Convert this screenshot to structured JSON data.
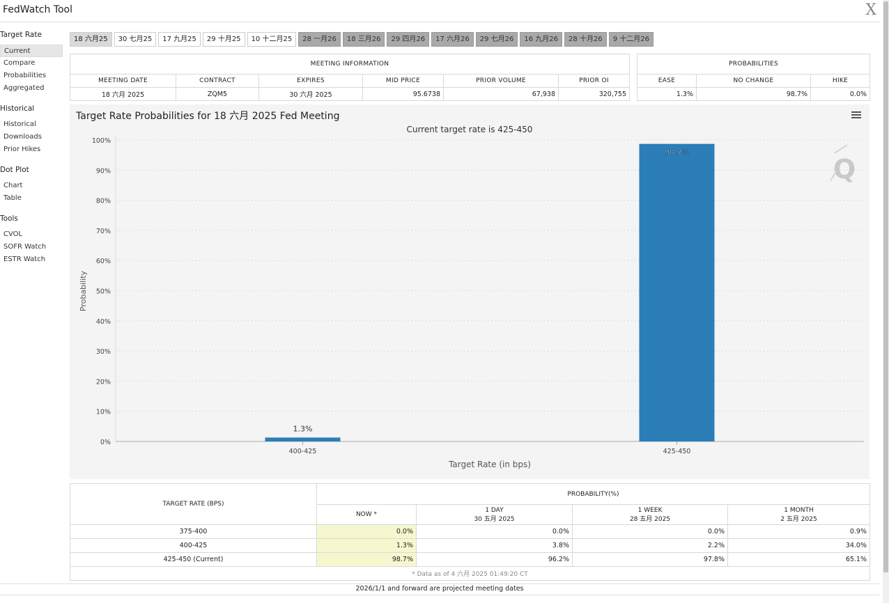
{
  "app": {
    "title": "FedWatch Tool",
    "close_label": "X"
  },
  "sidebar": {
    "groups": [
      {
        "label": "Target Rate",
        "items": [
          "Current",
          "Compare",
          "Probabilities",
          "Aggregated"
        ]
      },
      {
        "label": "Historical",
        "items": [
          "Historical",
          "Downloads",
          "Prior Hikes"
        ]
      },
      {
        "label": "Dot Plot",
        "items": [
          "Chart",
          "Table"
        ]
      },
      {
        "label": "Tools",
        "items": [
          "CVOL",
          "SOFR Watch",
          "ESTR Watch"
        ]
      }
    ],
    "active": "Current"
  },
  "tabs": [
    {
      "label": "18 六月25",
      "state": "selected"
    },
    {
      "label": "30 七月25",
      "state": "normal"
    },
    {
      "label": "17 九月25",
      "state": "normal"
    },
    {
      "label": "29 十月25",
      "state": "normal"
    },
    {
      "label": "10 十二月25",
      "state": "normal"
    },
    {
      "label": "28 一月26",
      "state": "future"
    },
    {
      "label": "18 三月26",
      "state": "future"
    },
    {
      "label": "29 四月26",
      "state": "future"
    },
    {
      "label": "17 六月26",
      "state": "future"
    },
    {
      "label": "29 七月26",
      "state": "future"
    },
    {
      "label": "16 九月26",
      "state": "future"
    },
    {
      "label": "28 十月26",
      "state": "future"
    },
    {
      "label": "9 十二月26",
      "state": "future"
    }
  ],
  "meeting_info": {
    "header": "MEETING INFORMATION",
    "columns": [
      "MEETING DATE",
      "CONTRACT",
      "EXPIRES",
      "MID PRICE",
      "PRIOR VOLUME",
      "PRIOR OI"
    ],
    "row": [
      "18 六月 2025",
      "ZQM5",
      "30 六月 2025",
      "95.6738",
      "67,938",
      "320,755"
    ]
  },
  "probabilities": {
    "header": "PROBABILITIES",
    "columns": [
      "EASE",
      "NO CHANGE",
      "HIKE"
    ],
    "row": [
      "1.3%",
      "98.7%",
      "0.0%"
    ]
  },
  "chart_panel": {
    "title": "Target Rate Probabilities for 18 六月 2025 Fed Meeting",
    "menu_icon": "hamburger-menu-icon",
    "watermark_icon": "q-logo-icon"
  },
  "chart_data": {
    "type": "bar",
    "title": "Current target rate is 425-450",
    "xlabel": "Target Rate (in bps)",
    "ylabel": "Probability",
    "categories": [
      "400-425",
      "425-450"
    ],
    "values": [
      1.3,
      98.7
    ],
    "value_labels": [
      "1.3%",
      "98.7%"
    ],
    "ylim": [
      0,
      100
    ],
    "yticks": [
      "0%",
      "10%",
      "20%",
      "30%",
      "40%",
      "50%",
      "60%",
      "70%",
      "80%",
      "90%",
      "100%"
    ],
    "grid": true,
    "bar_color": "#2b7eb8"
  },
  "prob_table": {
    "col1_header": "TARGET RATE (BPS)",
    "group_header": "PROBABILITY(%)",
    "columns": [
      {
        "line1": "NOW *",
        "line2": ""
      },
      {
        "line1": "1 DAY",
        "line2": "30 五月 2025"
      },
      {
        "line1": "1 WEEK",
        "line2": "28 五月 2025"
      },
      {
        "line1": "1 MONTH",
        "line2": "2 五月 2025"
      }
    ],
    "rows": [
      {
        "rate": "375-400",
        "values": [
          "0.0%",
          "0.0%",
          "0.0%",
          "0.9%"
        ]
      },
      {
        "rate": "400-425",
        "values": [
          "1.3%",
          "3.8%",
          "2.2%",
          "34.0%"
        ]
      },
      {
        "rate": "425-450 (Current)",
        "values": [
          "98.7%",
          "96.2%",
          "97.8%",
          "65.1%"
        ]
      }
    ],
    "footnote": "* Data as of 4 六月 2025 01:49:20 CT"
  },
  "projected_note": "2026/1/1 and forward are projected meeting dates"
}
